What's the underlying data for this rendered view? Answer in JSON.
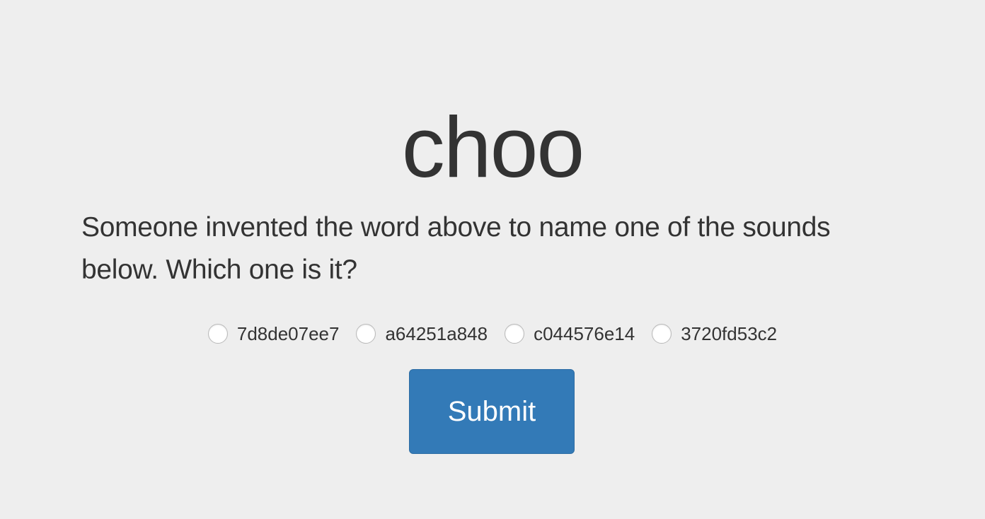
{
  "word": "choo",
  "prompt": "Someone invented the word above to name one of the sounds below. Which one is it?",
  "options": [
    {
      "label": "7d8de07ee7"
    },
    {
      "label": "a64251a848"
    },
    {
      "label": "c044576e14"
    },
    {
      "label": "3720fd53c2"
    }
  ],
  "submit_label": "Submit",
  "colors": {
    "background": "#eeeeee",
    "text": "#333333",
    "button": "#337ab7",
    "button_border": "#2e6da4"
  }
}
